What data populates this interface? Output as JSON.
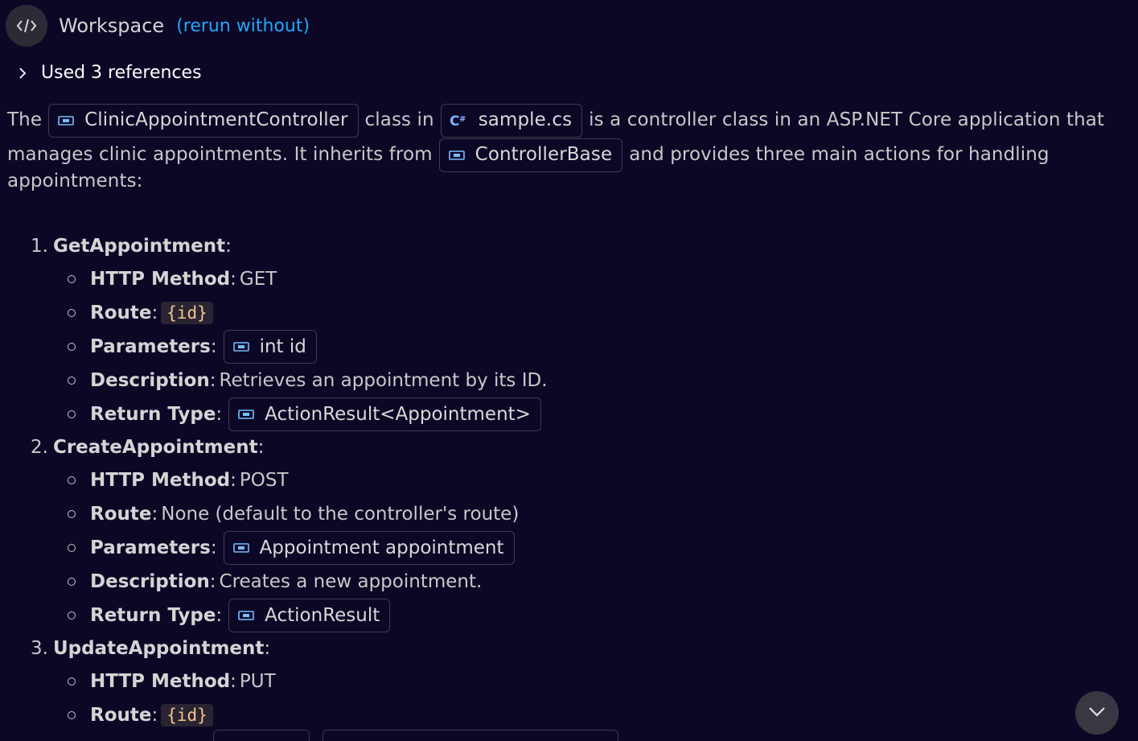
{
  "header": {
    "title": "Workspace",
    "rerun": "(rerun without)"
  },
  "references": {
    "label": "Used 3 references"
  },
  "intro": {
    "t1": "The",
    "chip_controller": "ClinicAppointmentController",
    "t2": "class in",
    "chip_file": "sample.cs",
    "t3": "is a controller class in an ASP.NET Core application that",
    "t4": "manages clinic appointments. It inherits from",
    "chip_base": "ControllerBase",
    "t5": "and provides three main actions for handling",
    "t6": "appointments:"
  },
  "labels": {
    "http_method": "HTTP Method",
    "route": "Route",
    "parameters": "Parameters",
    "description": "Description",
    "return_type": "Return Type",
    "colon": ":"
  },
  "actions": [
    {
      "number": "1.",
      "name": "GetAppointment",
      "http_method": "GET",
      "route_code": "{id}",
      "parameters": "int id",
      "description": "Retrieves an appointment by its ID.",
      "return_type": "ActionResult<Appointment>"
    },
    {
      "number": "2.",
      "name": "CreateAppointment",
      "http_method": "POST",
      "route_text": "None (default to the controller's route)",
      "parameters": "Appointment appointment",
      "description": "Creates a new appointment.",
      "return_type": "ActionResult"
    },
    {
      "number": "3.",
      "name": "UpdateAppointment",
      "http_method": "PUT",
      "route_code": "{id}"
    }
  ],
  "colors": {
    "background": "#0d0726",
    "link": "#1ea7f7",
    "symbol_icon": "#75beff",
    "code_text": "#f2c48e"
  },
  "icons": {
    "avatar": "code-icon",
    "references": "chevron-right-icon",
    "symbol": "symbol-variable-icon",
    "file": "csharp-file-icon",
    "scroll": "chevron-down-icon"
  }
}
